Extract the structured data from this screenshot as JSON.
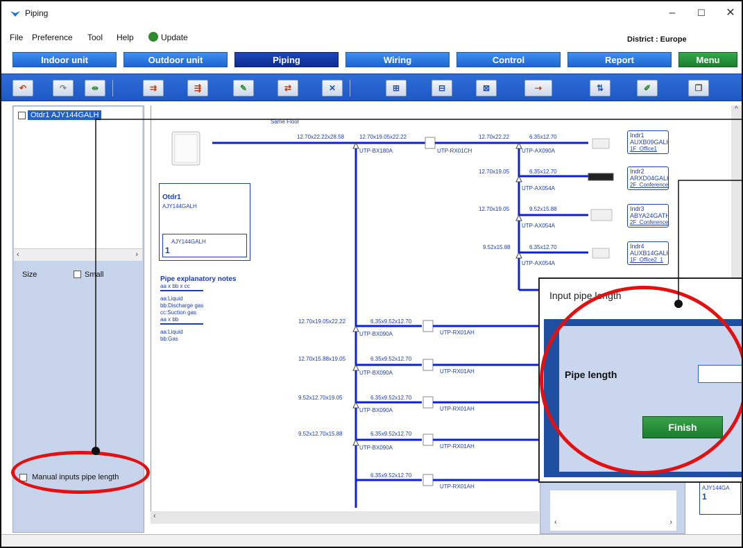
{
  "window": {
    "title": "Piping",
    "district": "District : Europe"
  },
  "menu": [
    "File",
    "Preference",
    "Tool",
    "Help",
    "Update"
  ],
  "tabs": [
    "Indoor unit",
    "Outdoor unit",
    "Piping",
    "Wiring",
    "Control",
    "Report",
    "Menu"
  ],
  "active_tab": "Piping",
  "colors": {
    "accent": "#1d66d0",
    "active_tab": "#0e2c93",
    "menu_tab": "#1b7e30",
    "pipe": "#0b1fe0",
    "callout_ring": "#e21010",
    "finish": "#1b7b2f"
  },
  "toolbar_icons": [
    "undo-icon",
    "redo-icon",
    "auto-pipe-icon",
    "branch-left-icon",
    "branch-right-icon",
    "edit-pipe-icon",
    "swap-branch-icon",
    "delete-pipe-icon",
    "add-header-icon",
    "insert-header-icon",
    "delete-header-icon",
    "route-icon",
    "move-up-down-icon",
    "edit-icon",
    "copy-icon"
  ],
  "tree": {
    "item": "Otdr1 AJY144GALH"
  },
  "left": {
    "size_label": "Size",
    "small_label": "Small",
    "manual_label": "Manual inputs pipe length"
  },
  "canvas": {
    "same_floor": "Same Floor",
    "outdoor": {
      "name": "Otdr1",
      "model": "AJY144GALH",
      "inner_model": "AJY144GALH",
      "inner_count": "1"
    },
    "first_pipe": "12.70x22.22x28.58",
    "first_joint": "UTP-BX180A",
    "second_pipe": "12.70x19.05x22.22",
    "header": "UTP-RX01CH",
    "branches": [
      {
        "main": "12.70x22.22",
        "sub": "6.35x12.70",
        "joint": "UTP-AX090A"
      },
      {
        "main": "12.70x19.05",
        "sub": "6.35x12.70",
        "joint": "UTP-AX054A"
      },
      {
        "main": "12.70x19.05",
        "sub": "9.52x15.88",
        "joint": "UTP-AX054A"
      },
      {
        "main": "9.52x15.88",
        "sub": "6.35x12.70",
        "joint": "UTP-AX054A"
      }
    ],
    "indoors": [
      {
        "name": "Indr1",
        "model": "AUXB09GALH",
        "room": "1F_Office1"
      },
      {
        "name": "Indr2",
        "model": "ARXD04GALH",
        "room": "2F_Conference1"
      },
      {
        "name": "Indr3",
        "model": "ABYA24GATH",
        "room": "2F_Conference2"
      },
      {
        "name": "Indr4",
        "model": "AUXB14GALH",
        "room": "1F_Office2_1"
      }
    ],
    "lower": [
      {
        "left": "12.70x19.05x22.22",
        "right": "6.35x9.52x12.70",
        "joint": "UTP-BX090A",
        "header": "UTP-RX01AH"
      },
      {
        "left": "12.70x15.88x19.05",
        "right": "6.35x9.52x12.70",
        "joint": "UTP-BX090A",
        "header": "UTP-RX01AH"
      },
      {
        "left": "9.52x12.70x19.05",
        "right": "6.35x9.52x12.70",
        "joint": "UTP-BX090A",
        "header": "UTP-RX01AH"
      },
      {
        "left": "9.52x12.70x15.88",
        "right": "6.35x9.52x12.70",
        "joint": "UTP-BX090A",
        "header": "UTP-RX01AH"
      },
      {
        "left": "",
        "right": "6.35x9.52x12.70",
        "joint": "",
        "header": "UTP-RX01AH"
      }
    ],
    "notes": {
      "title": "Pipe explanatory notes",
      "f1": "aa x bb x cc",
      "l1": "aa:Liquid",
      "l2": "bb:Discharge gas",
      "l3": "cc:Suction gas",
      "f2": "aa x bb",
      "l4": "aa:Liquid",
      "l5": "bb:Gas"
    },
    "bottom_box": {
      "model": "AJY144GA",
      "count": "1"
    }
  },
  "dialog": {
    "title": "Input pipe length",
    "label": "Pipe length",
    "value": "",
    "button": "Finish"
  }
}
